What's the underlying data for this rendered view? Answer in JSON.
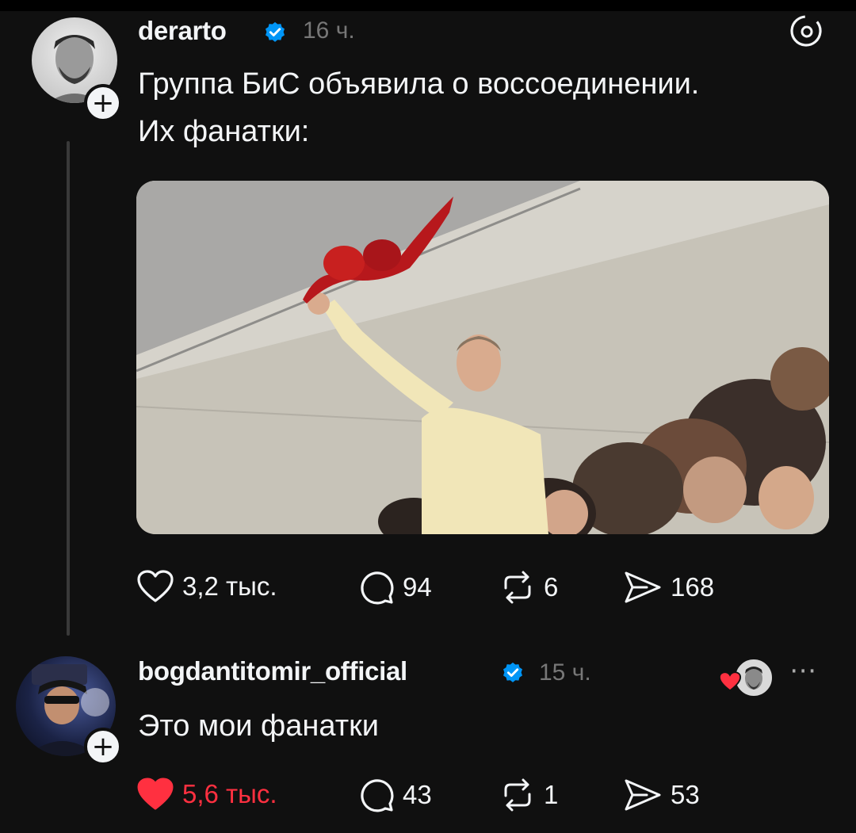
{
  "post": {
    "username": "derarto",
    "time": "16 ч.",
    "text_line1": "Группа БиС объявила о воссоединении.",
    "text_line2": "Их фанатки:",
    "actions": {
      "likes": "3,2 тыс.",
      "replies": "94",
      "reposts": "6",
      "shares": "168"
    }
  },
  "reply": {
    "username": "bogdantitomir_official",
    "time": "15 ч.",
    "text": "Это мои фанатки",
    "actions": {
      "likes": "5,6 тыс.",
      "replies": "43",
      "reposts": "1",
      "shares": "53"
    }
  },
  "colors": {
    "background": "#101010",
    "text": "#f3f5f7",
    "muted": "#777777",
    "verified": "#0095f6",
    "liked": "#ff3040"
  },
  "icons": [
    "threads-logo-icon",
    "verified-icon",
    "heart-icon",
    "comment-icon",
    "repost-icon",
    "share-icon",
    "plus-icon",
    "more-icon"
  ]
}
